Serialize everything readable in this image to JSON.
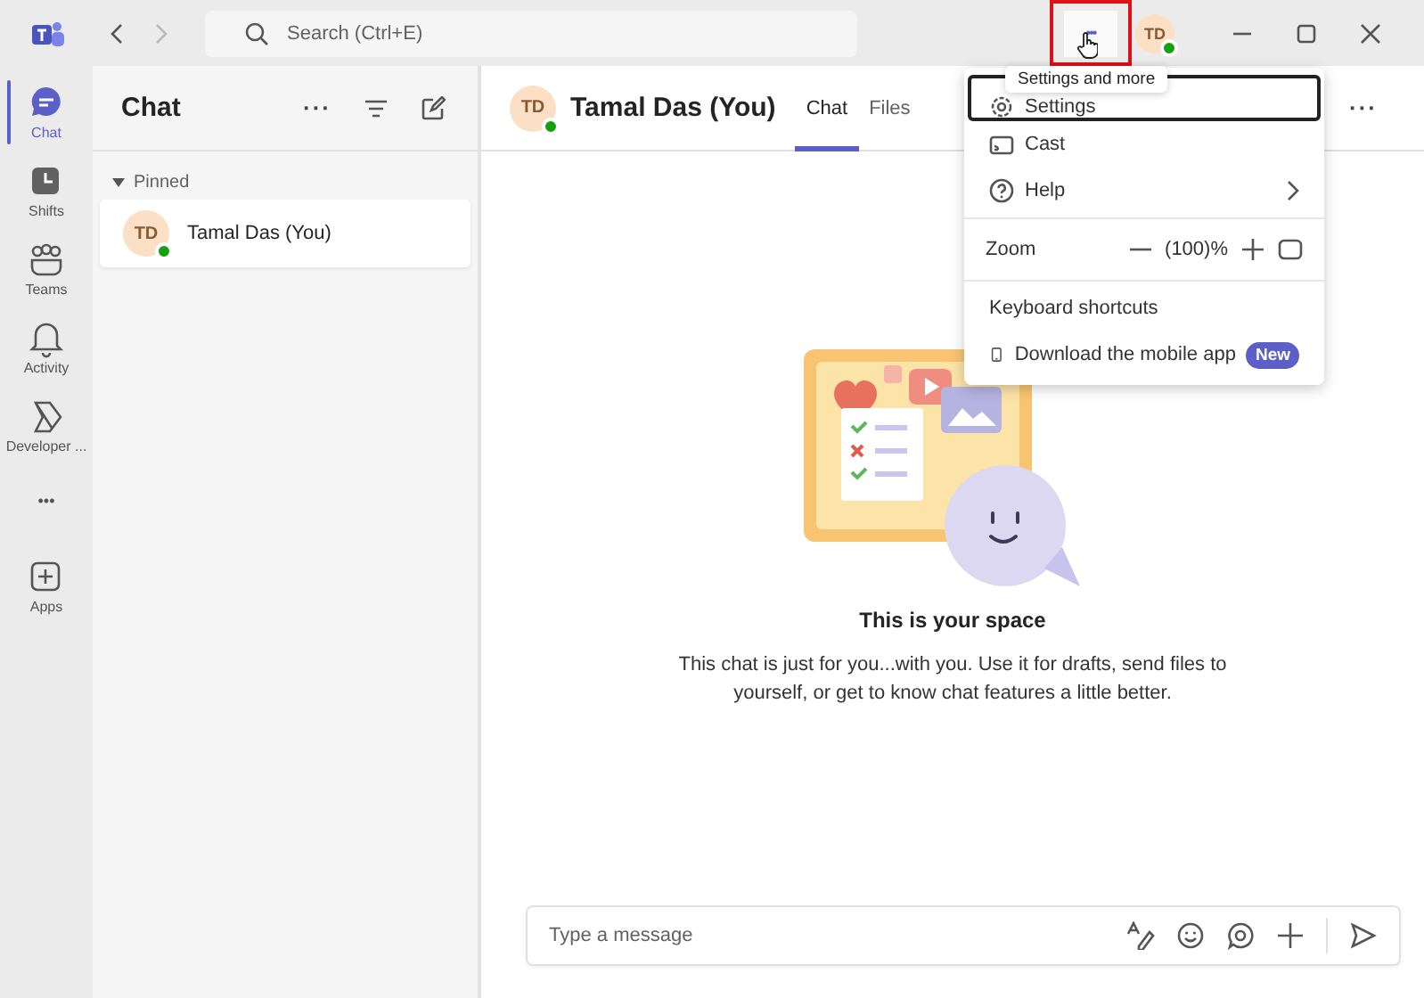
{
  "titlebar": {
    "search": {
      "placeholder": "Search (Ctrl+E)"
    },
    "avatar": "TD",
    "more": "•••",
    "tooltip": "Settings and more",
    "highlighted": true
  },
  "rail": [
    {
      "kind": "app",
      "label": "Chat",
      "selected": true
    },
    {
      "kind": "app",
      "label": "Shifts",
      "selected": false
    },
    {
      "kind": "app",
      "label": "Teams",
      "selected": false
    },
    {
      "kind": "app",
      "label": "Activity",
      "selected": false
    },
    {
      "kind": "app",
      "label": "Developer ...",
      "selected": false
    },
    {
      "kind": "more",
      "label": "•••"
    },
    {
      "kind": "app",
      "label": "Apps",
      "selected": false
    }
  ],
  "chat_list": {
    "title": "Chat",
    "more": "···",
    "section": "Pinned",
    "items": [
      {
        "avatar": "TD",
        "name": "Tamal Das (You)",
        "selected": true
      }
    ]
  },
  "conversation": {
    "avatar": "TD",
    "name": "Tamal Das (You)",
    "tabs": [
      {
        "label": "Chat",
        "selected": true
      },
      {
        "label": "Files",
        "selected": false
      }
    ],
    "more": "···",
    "heading": "This is your space",
    "text": "This chat is just for you...with you. Use it for drafts, send files to yourself, or get to know chat features a little better.",
    "composer": {
      "placeholder": "Type a message"
    }
  },
  "menu": [
    [
      {
        "kind": "item",
        "label": "Settings",
        "focused": true,
        "submenu": false
      },
      {
        "kind": "item",
        "label": "Cast",
        "focused": false,
        "submenu": false
      },
      {
        "kind": "item",
        "label": "Help",
        "focused": false,
        "submenu": true
      }
    ],
    [
      {
        "kind": "zoom",
        "label": "Zoom",
        "value": "(100)%"
      }
    ],
    [
      {
        "kind": "item",
        "label": "Keyboard shortcuts",
        "focused": false,
        "submenu": false
      },
      {
        "kind": "item",
        "label": "Download the mobile app",
        "badge": "New",
        "focused": false,
        "submenu": false
      }
    ]
  ]
}
